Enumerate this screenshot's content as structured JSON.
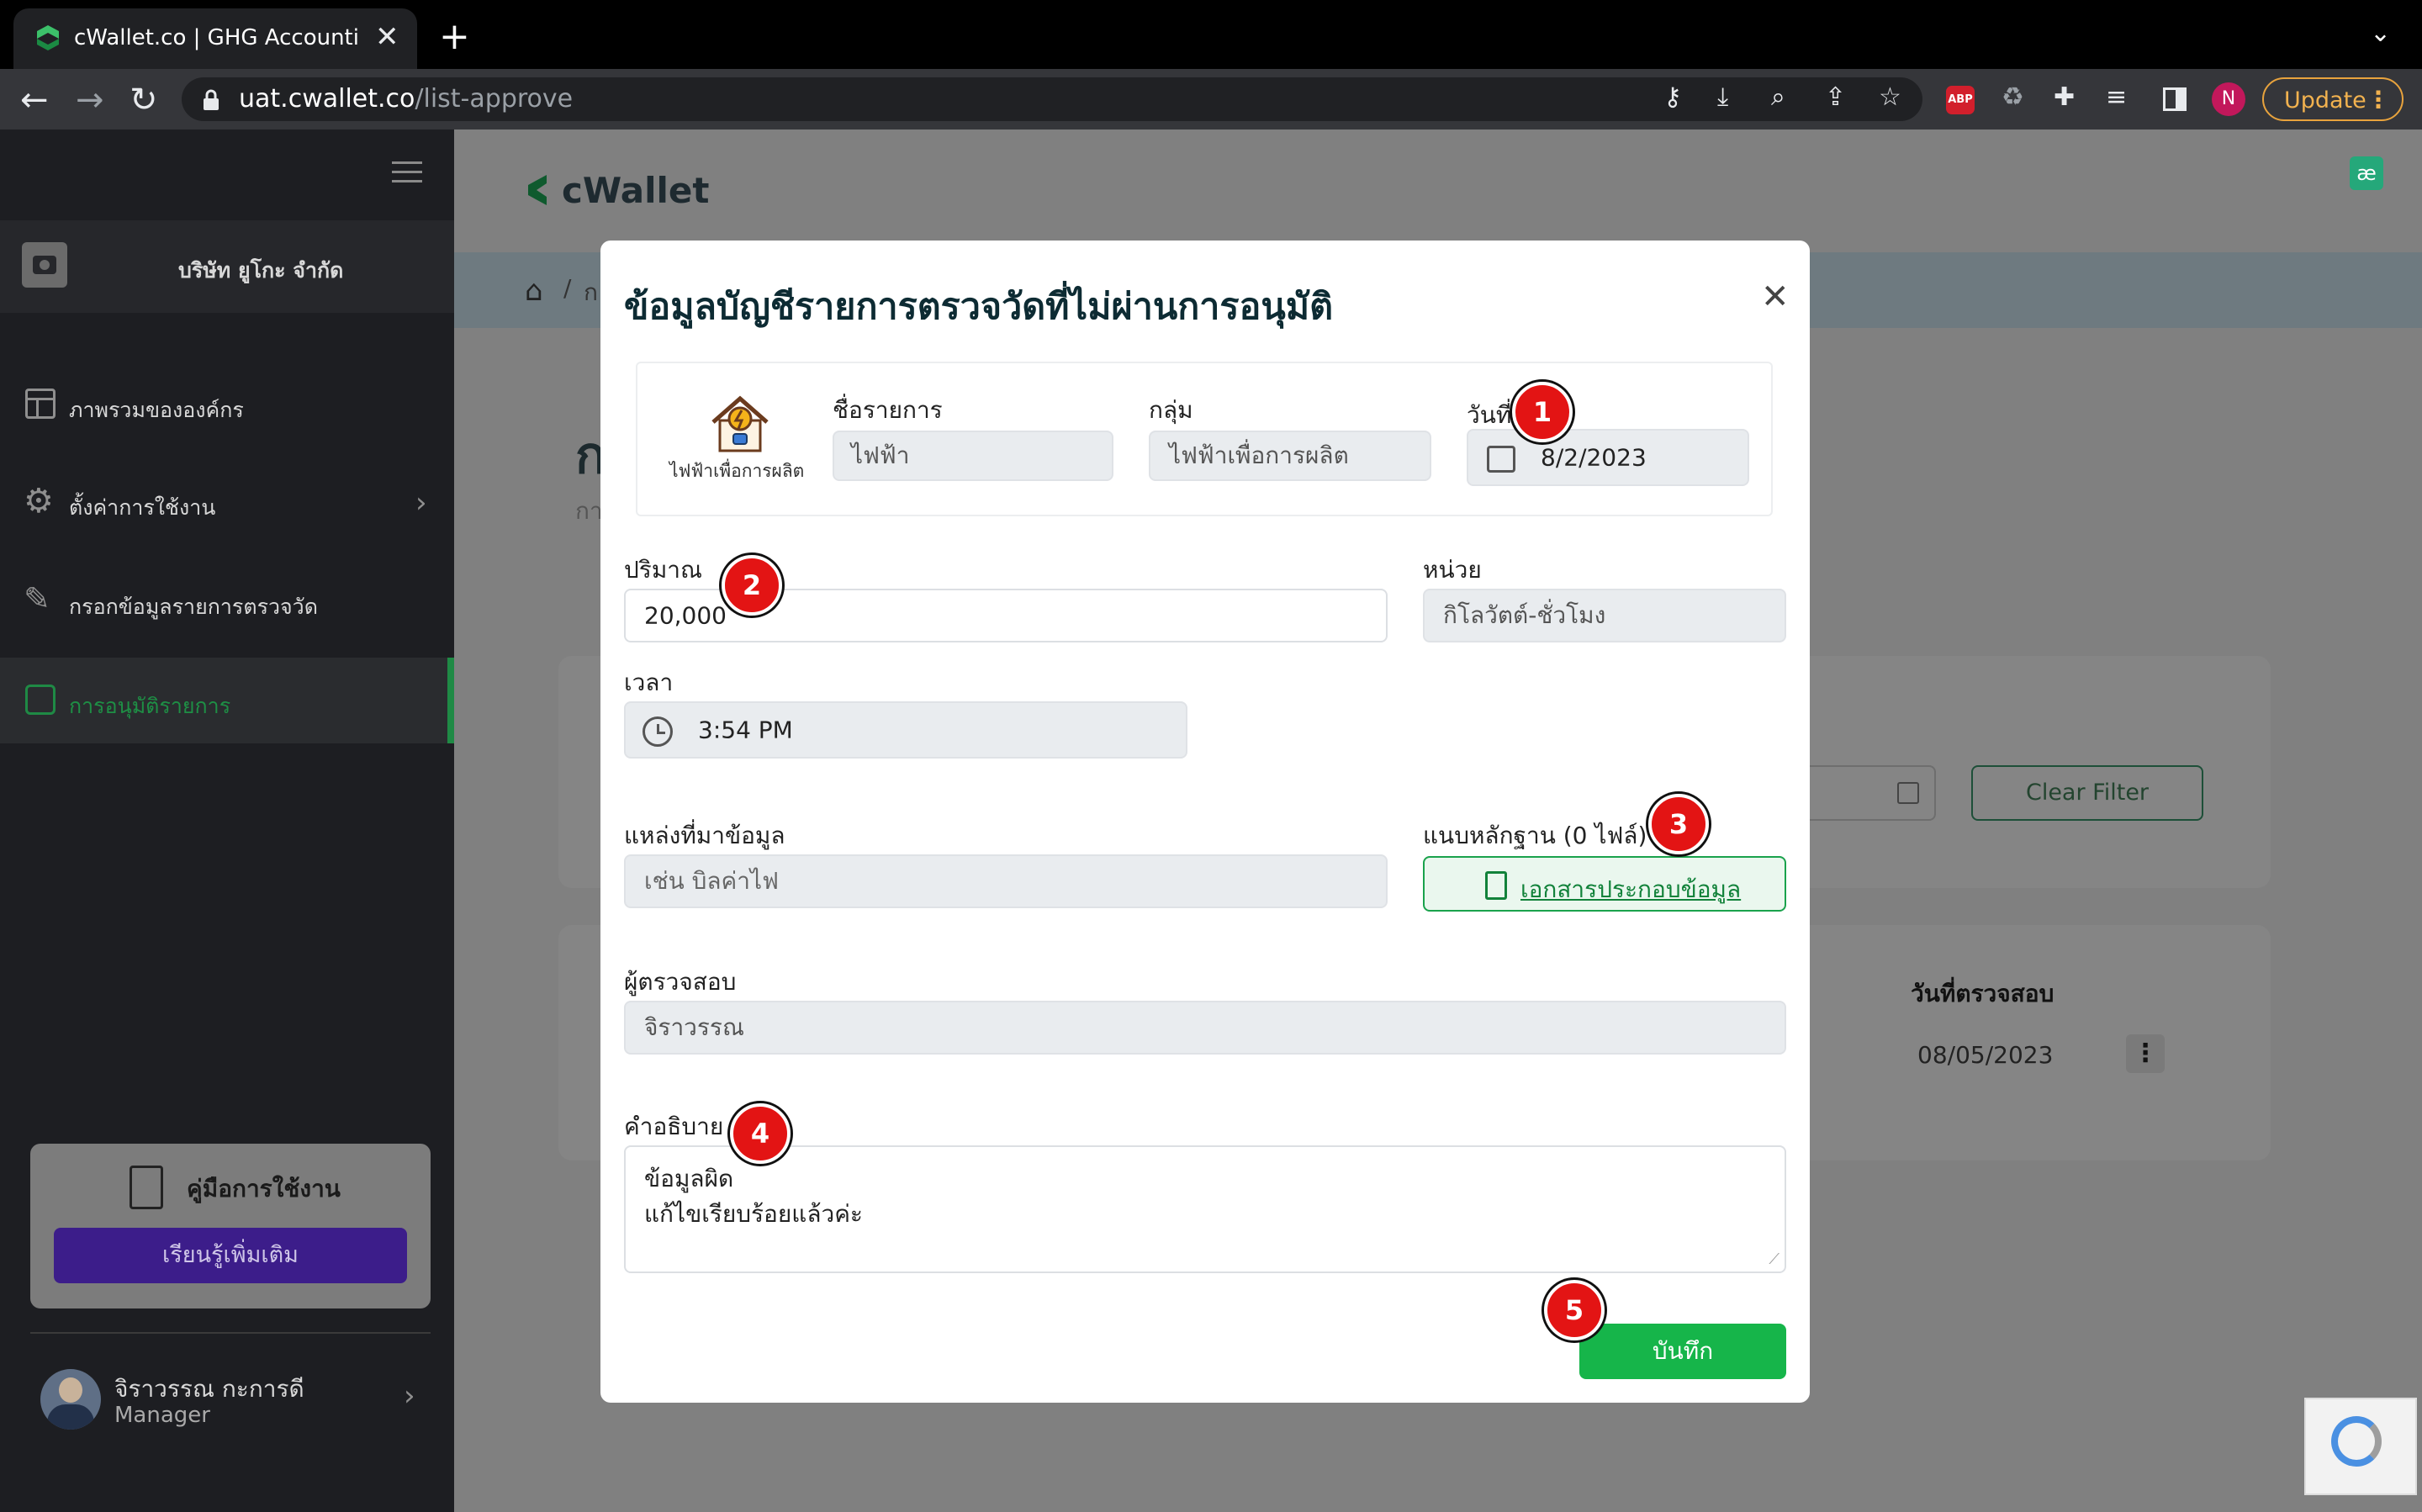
{
  "browser": {
    "tab_title": "cWallet.co | GHG Accounting S",
    "url_host": "uat.cwallet.co",
    "url_path": "/list-approve",
    "update_label": "Update",
    "profile_initial": "N",
    "abp_label": "ABP"
  },
  "sidebar": {
    "company_name": "บริษัท ยูโกะ จำกัด",
    "items": [
      {
        "label": "ภาพรวมขององค์กร",
        "icon": "layout-icon"
      },
      {
        "label": "ตั้งค่าการใช้งาน",
        "icon": "gear-icon"
      },
      {
        "label": "กรอกข้อมูลรายการตรวจวัด",
        "icon": "pencil-icon"
      },
      {
        "label": "การอนุมัติรายการ",
        "icon": "approve-icon"
      }
    ],
    "manual_title": "คู่มือการใช้งาน",
    "manual_button": "เรียนรู้เพิ่มเติม",
    "user_name": "จิราวรรณ กะการดี",
    "user_role": "Manager"
  },
  "main": {
    "logo_text": "cWallet",
    "breadcrumb_sep": "/",
    "breadcrumb_partial": "ก",
    "page_title_partial": "ก",
    "page_subtitle_partial": "กา",
    "clear_filter": "Clear Filter",
    "column_header_date": "วันที่ตรวจสอบ",
    "row_date": "08/05/2023"
  },
  "modal": {
    "title": "ข้อมูลบัญชีรายการตรวจวัดที่ไม่ผ่านการอนุมัติ",
    "item_icon_caption": "ไฟฟ้าเพื่อการผลิต",
    "name_label": "ชื่อรายการ",
    "name_value": "ไฟฟ้า",
    "group_label": "กลุ่ม",
    "group_value": "ไฟฟ้าเพื่อการผลิต",
    "date_label": "วันที่",
    "date_value": "8/2/2023",
    "quantity_label": "ปริมาณ",
    "quantity_value": "20,000",
    "unit_label": "หน่วย",
    "unit_value": "กิโลวัตต์-ชั่วโมง",
    "time_label": "เวลา",
    "time_value": "3:54 PM",
    "source_label": "แหล่งที่มาข้อมูล",
    "source_placeholder": "เช่น บิลค่าไฟ",
    "evidence_label": "แนบหลักฐาน (0 ไฟล์)",
    "evidence_button": "เอกสารประกอบข้อมูล",
    "inspector_label": "ผู้ตรวจสอบ",
    "inspector_value": "จิราวรรณ",
    "description_label": "คำอธิบาย",
    "description_lines": [
      "ข้อมูลผิด",
      "แก้ไขเรียบร้อยแล้วค่ะ"
    ],
    "save_button": "บันทึก"
  },
  "badges": [
    "1",
    "2",
    "3",
    "4",
    "5"
  ],
  "colors": {
    "brand_green": "#16b54a",
    "badge_red": "#e31414",
    "sidebar_bg": "#1d1e22",
    "manual_button": "#3c1d8a"
  }
}
